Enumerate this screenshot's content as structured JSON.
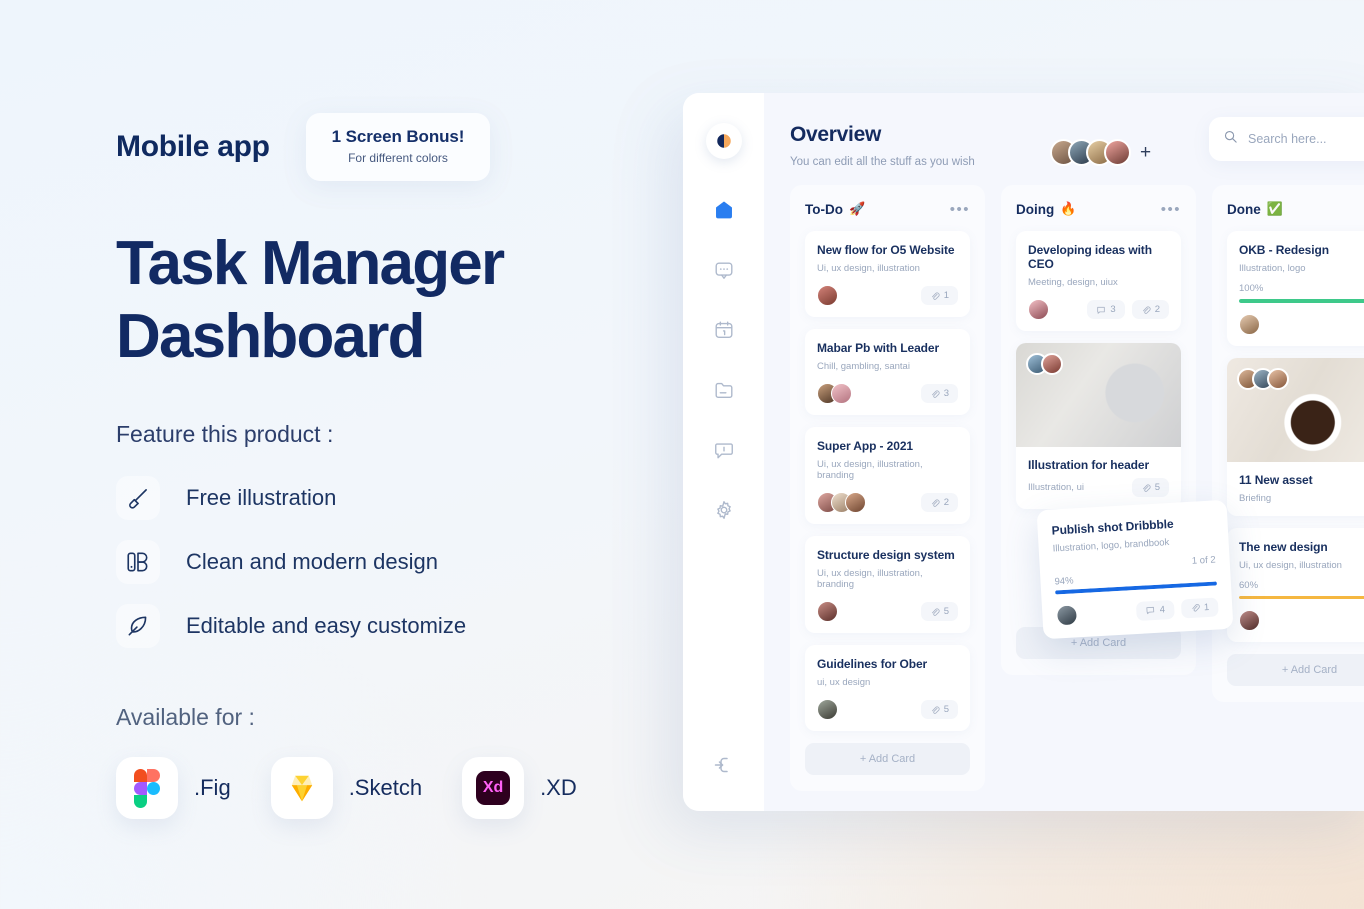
{
  "promo": {
    "kicker": "Mobile app",
    "badge": {
      "title": "1 Screen Bonus!",
      "subtitle": "For different colors"
    },
    "title_line1": "Task Manager",
    "title_line2": "Dashboard",
    "feature_label": "Feature this product :",
    "features": [
      {
        "icon": "paint-brush-icon",
        "label": "Free illustration"
      },
      {
        "icon": "design-layers-icon",
        "label": "Clean and modern design"
      },
      {
        "icon": "feather-pen-icon",
        "label": "Editable and easy customize"
      }
    ],
    "available_label": "Available for :",
    "formats": [
      {
        "icon": "figma-icon",
        "label": ".Fig"
      },
      {
        "icon": "sketch-icon",
        "label": ".Sketch"
      },
      {
        "icon": "adobe-xd-icon",
        "label": ".XD"
      }
    ]
  },
  "dashboard": {
    "logo": "app-logo",
    "nav": [
      {
        "name": "home",
        "icon": "home-icon",
        "active": true
      },
      {
        "name": "chat",
        "icon": "chat-bubble-icon",
        "active": false
      },
      {
        "name": "calendar",
        "icon": "calendar-icon",
        "active": false
      },
      {
        "name": "files",
        "icon": "folder-icon",
        "active": false
      },
      {
        "name": "messages",
        "icon": "message-icon",
        "active": false
      },
      {
        "name": "settings",
        "icon": "gear-icon",
        "active": false
      }
    ],
    "logout_icon": "logout-icon",
    "header": {
      "title": "Overview",
      "subtitle": "You can edit all the stuff as you wish",
      "add_member_label": "+",
      "members_count": 4
    },
    "search": {
      "icon": "search-icon",
      "placeholder": "Search here..."
    },
    "add_card_label": "+ Add Card",
    "columns": [
      {
        "title": "To-Do",
        "emoji": "🚀",
        "menu": "•••",
        "cards": [
          {
            "title": "New flow for O5 Website",
            "tags": "Ui, ux design, illustration",
            "avatars": 1,
            "metas": [
              {
                "icon": "attachment-icon",
                "value": "1"
              }
            ]
          },
          {
            "title": "Mabar Pb with Leader",
            "tags": "Chill, gambling, santai",
            "avatars": 2,
            "metas": [
              {
                "icon": "attachment-icon",
                "value": "3"
              }
            ]
          },
          {
            "title": "Super App - 2021",
            "tags": "Ui, ux design, illustration, branding",
            "avatars": 3,
            "metas": [
              {
                "icon": "attachment-icon",
                "value": "2"
              }
            ]
          },
          {
            "title": "Structure design system",
            "tags": "Ui, ux design, illustration, branding",
            "avatars": 1,
            "metas": [
              {
                "icon": "attachment-icon",
                "value": "5"
              }
            ]
          },
          {
            "title": "Guidelines for Ober",
            "tags": "ui, ux design",
            "avatars": 1,
            "metas": [
              {
                "icon": "attachment-icon",
                "value": "5"
              }
            ]
          }
        ]
      },
      {
        "title": "Doing",
        "emoji": "🔥",
        "menu": "•••",
        "cards": [
          {
            "title": "Developing ideas with CEO",
            "tags": "Meeting, design, uiux",
            "avatars": 1,
            "metas": [
              {
                "icon": "comment-icon",
                "value": "3"
              },
              {
                "icon": "attachment-icon",
                "value": "2"
              }
            ]
          },
          {
            "title": "Illustration for header",
            "tags": "Illustration, ui",
            "photo": "clipboard-laptop-photo",
            "photo_avatars": 2,
            "metas": [
              {
                "icon": "attachment-icon",
                "value": "5"
              }
            ]
          }
        ]
      },
      {
        "title": "Done",
        "emoji": "✅",
        "menu": "•••",
        "cards": [
          {
            "title": "OKB - Redesign",
            "tags": "Illustration, logo",
            "progress": "100%",
            "progress_color": "#3ec98a",
            "avatars": 1
          },
          {
            "title": "11 New asset",
            "tags": "Briefing",
            "photo": "coffee-desk-photo",
            "photo_avatars": 3
          },
          {
            "title": "The new design",
            "tags": "Ui, ux design, illustration",
            "progress": "60%",
            "progress_color": "#f5b740",
            "avatars": 1
          }
        ]
      }
    ],
    "floating_card": {
      "title": "Publish shot Dribbble",
      "tags": "Illustration, logo, brandbook",
      "counter": "1 of 2",
      "progress": "94%",
      "progress_color": "#1668e3",
      "metas": [
        {
          "icon": "comment-icon",
          "value": "4"
        },
        {
          "icon": "attachment-icon",
          "value": "1"
        }
      ]
    }
  },
  "colors": {
    "navy": "#122a63",
    "accent_blue": "#2a7ef0",
    "progress_green": "#3ec98a",
    "progress_yellow": "#f5b740",
    "progress_blue": "#1668e3"
  }
}
